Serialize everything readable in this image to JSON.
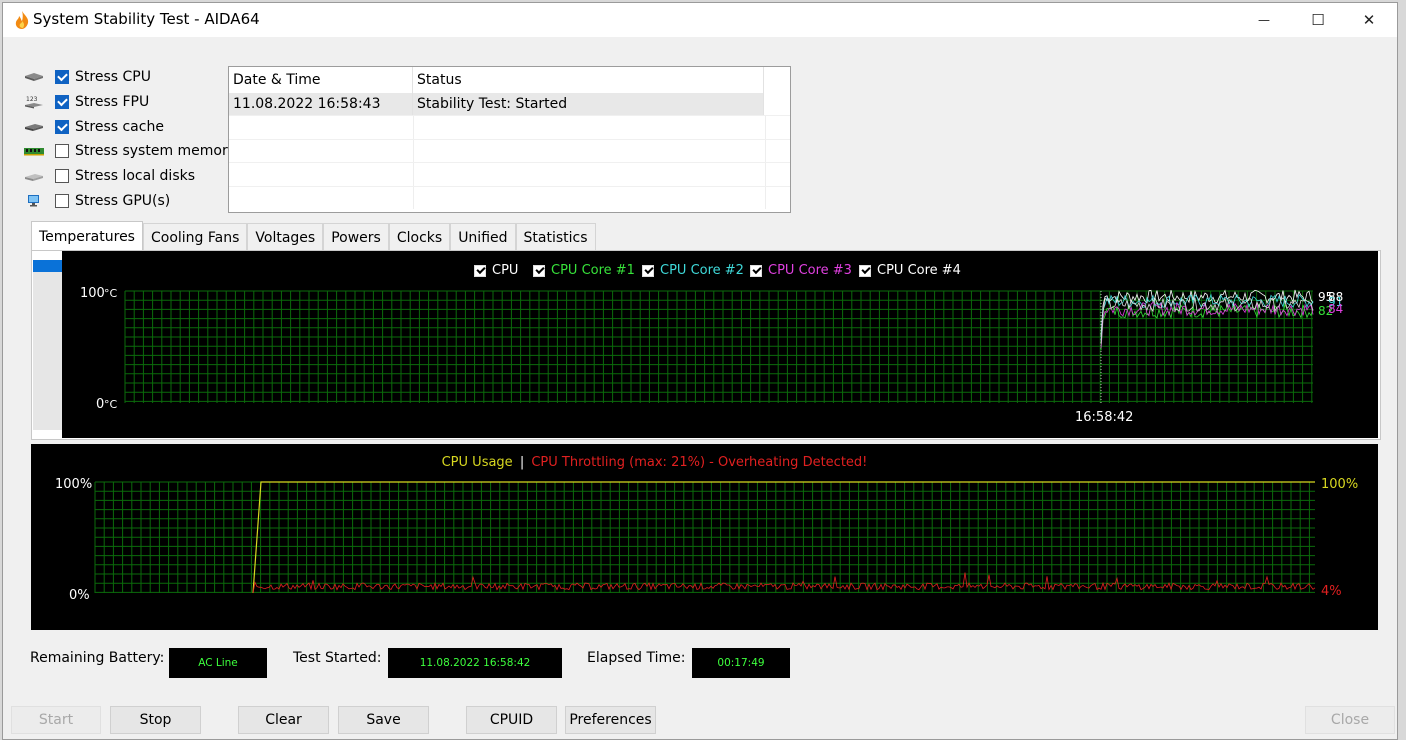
{
  "window": {
    "title": "System Stability Test - AIDA64"
  },
  "window_controls": {
    "minimize": "—",
    "maximize": "☐",
    "close": "✕"
  },
  "stress_options": [
    {
      "label": "Stress CPU",
      "checked": true,
      "icon": "cpu-chip-icon"
    },
    {
      "label": "Stress FPU",
      "checked": true,
      "icon": "fpu-123-icon"
    },
    {
      "label": "Stress cache",
      "checked": true,
      "icon": "cache-chip-icon"
    },
    {
      "label": "Stress system memory",
      "checked": false,
      "icon": "memory-module-icon"
    },
    {
      "label": "Stress local disks",
      "checked": false,
      "icon": "disk-drive-icon"
    },
    {
      "label": "Stress GPU(s)",
      "checked": false,
      "icon": "gpu-monitor-icon"
    }
  ],
  "log": {
    "columns": [
      "Date & Time",
      "Status"
    ],
    "rows": [
      {
        "datetime": "11.08.2022 16:58:43",
        "status": "Stability Test: Started"
      }
    ]
  },
  "tabs": [
    "Temperatures",
    "Cooling Fans",
    "Voltages",
    "Powers",
    "Clocks",
    "Unified",
    "Statistics"
  ],
  "temperature_chart": {
    "legend": [
      {
        "label": "CPU",
        "color": "#ffffff"
      },
      {
        "label": "CPU Core #1",
        "color": "#37e23a"
      },
      {
        "label": "CPU Core #2",
        "color": "#3fd9d9"
      },
      {
        "label": "CPU Core #3",
        "color": "#e040e0"
      },
      {
        "label": "CPU Core #4",
        "color": "#ffffff"
      }
    ],
    "y_top_label": "100",
    "y_bottom_label": "0",
    "unit": "°C",
    "time_label": "16:58:42",
    "end_values": [
      {
        "text": "95",
        "color": "#ffffff"
      },
      {
        "text": "91",
        "color": "#3fd9d9"
      },
      {
        "text": "88",
        "color": "#ffffff"
      },
      {
        "text": "82",
        "color": "#37e23a"
      },
      {
        "text": "84",
        "color": "#e040e0"
      }
    ]
  },
  "usage_chart": {
    "title_usage": "CPU Usage",
    "separator": "|",
    "title_throttle": "CPU Throttling (max: 21%) - Overheating Detected!",
    "usage_color": "#d8d820",
    "throttle_color": "#e02020",
    "y_top_label": "100%",
    "y_bottom_label": "0%",
    "right_top_label": "100%",
    "right_bottom_label": "4%"
  },
  "chart_data": [
    {
      "type": "line",
      "title": "",
      "ylabel": "°C",
      "ylim": [
        0,
        100
      ],
      "series": [
        {
          "name": "CPU",
          "end_value": 95
        },
        {
          "name": "CPU Core #1",
          "end_value": 82
        },
        {
          "name": "CPU Core #2",
          "end_value": 91
        },
        {
          "name": "CPU Core #3",
          "end_value": 84
        },
        {
          "name": "CPU Core #4",
          "end_value": 88
        }
      ],
      "x_labels": [
        "16:58:42"
      ],
      "grid": true,
      "legend_placement": "top"
    },
    {
      "type": "line",
      "title": "CPU Usage | CPU Throttling (max: 21%) - Overheating Detected!",
      "ylim": [
        0,
        100
      ],
      "series": [
        {
          "name": "CPU Usage",
          "start_value": 0,
          "end_value": 100
        },
        {
          "name": "CPU Throttling",
          "max": 21,
          "end_value": 4
        }
      ],
      "grid": true
    }
  ],
  "status": {
    "battery_label": "Remaining Battery:",
    "battery_value": "AC Line",
    "started_label": "Test Started:",
    "started_value": "11.08.2022 16:58:42",
    "elapsed_label": "Elapsed Time:",
    "elapsed_value": "00:17:49"
  },
  "buttons": {
    "start": "Start",
    "stop": "Stop",
    "clear": "Clear",
    "save": "Save",
    "cpuid": "CPUID",
    "preferences": "Preferences",
    "close": "Close"
  }
}
